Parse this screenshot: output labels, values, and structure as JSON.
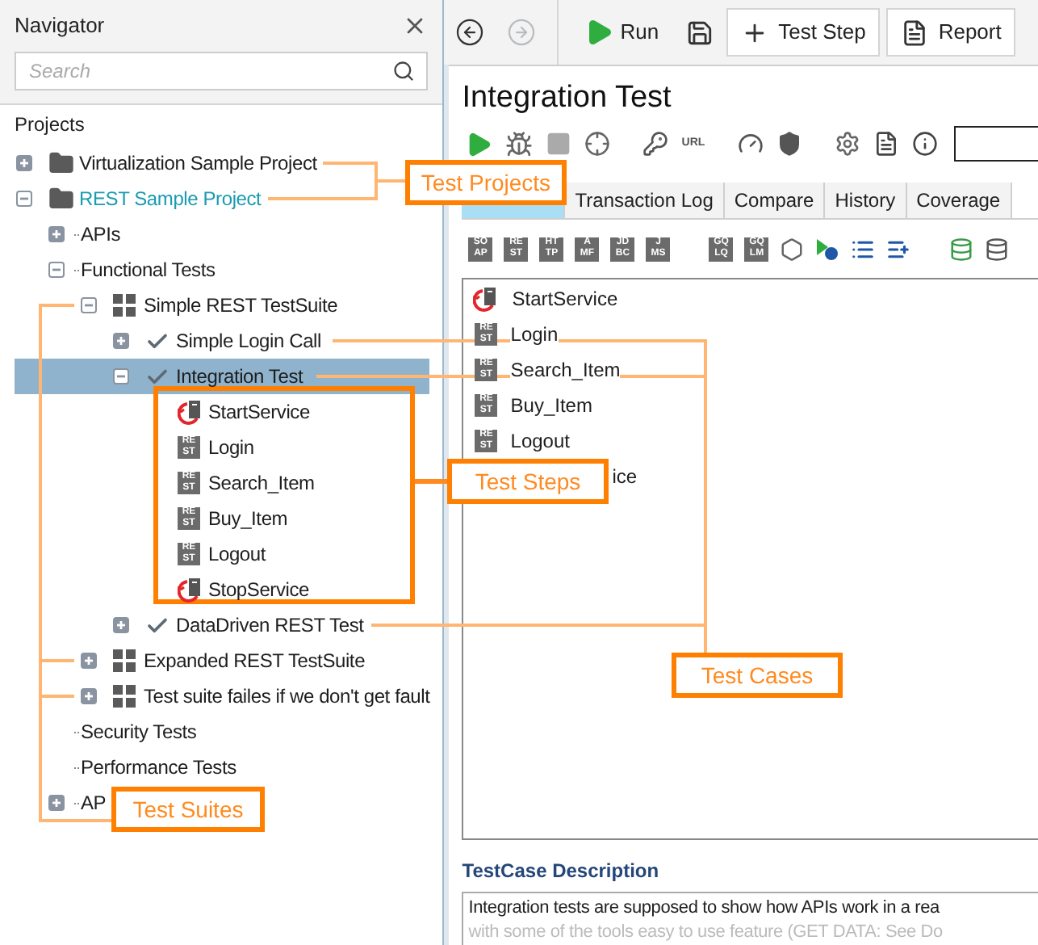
{
  "navigator": {
    "title": "Navigator",
    "search": {
      "placeholder": "Search"
    },
    "section": "Projects",
    "tree": [
      {
        "label": "Virtualization Sample Project",
        "kind": "project",
        "current": false,
        "selected": false,
        "expanded": false
      },
      {
        "label": "REST Sample Project",
        "kind": "project",
        "current": true,
        "selected": false,
        "expanded": true,
        "children": [
          {
            "label": "APIs",
            "kind": "folder",
            "selected": false,
            "expanded": false
          },
          {
            "label": "Functional Tests",
            "kind": "folder",
            "selected": false,
            "expanded": true,
            "children": [
              {
                "label": "Simple REST TestSuite",
                "kind": "suite",
                "selected": false,
                "expanded": true,
                "children": [
                  {
                    "label": "Simple Login Call",
                    "kind": "case",
                    "selected": false,
                    "expanded": false
                  },
                  {
                    "label": "Integration Test",
                    "kind": "case",
                    "selected": true,
                    "expanded": true,
                    "children": [
                      {
                        "label": "StartService",
                        "kind": "service",
                        "selected": false
                      },
                      {
                        "label": "Login",
                        "kind": "rest",
                        "badge": [
                          "RE",
                          "ST"
                        ],
                        "selected": false
                      },
                      {
                        "label": "Search_Item",
                        "kind": "rest",
                        "badge": [
                          "RE",
                          "ST"
                        ],
                        "selected": false
                      },
                      {
                        "label": "Buy_Item",
                        "kind": "rest",
                        "badge": [
                          "RE",
                          "ST"
                        ],
                        "selected": false
                      },
                      {
                        "label": "Logout",
                        "kind": "rest",
                        "badge": [
                          "RE",
                          "ST"
                        ],
                        "selected": false
                      },
                      {
                        "label": "StopService",
                        "kind": "service",
                        "selected": false
                      }
                    ]
                  },
                  {
                    "label": "DataDriven REST Test",
                    "kind": "case",
                    "selected": false,
                    "expanded": false
                  }
                ]
              },
              {
                "label": "Expanded REST TestSuite",
                "kind": "suite",
                "selected": false,
                "expanded": false
              },
              {
                "label": "Test suite failes if we don't get fault",
                "kind": "suite",
                "selected": false,
                "expanded": false
              }
            ]
          },
          {
            "label": "Security Tests",
            "kind": "folder",
            "selected": false
          },
          {
            "label": "Performance Tests",
            "kind": "folder",
            "selected": false
          },
          {
            "label": "AP",
            "kind": "folder",
            "selected": false,
            "expanded": false
          }
        ]
      }
    ]
  },
  "toolbar": [
    {
      "kind": "back",
      "disabled": false
    },
    {
      "kind": "forward",
      "disabled": true
    },
    {
      "kind": "run",
      "label": "Run"
    },
    {
      "kind": "save"
    },
    {
      "kind": "add",
      "label": "Test Step"
    },
    {
      "kind": "report",
      "label": "Report"
    }
  ],
  "editor": {
    "title": "Integration Test",
    "tools": [
      {
        "kind": "play"
      },
      {
        "kind": "bug"
      },
      {
        "kind": "stop"
      },
      {
        "kind": "target"
      },
      {
        "kind": "key"
      },
      {
        "kind": "url",
        "label": "URL"
      },
      {
        "kind": "gauge"
      },
      {
        "kind": "shield"
      },
      {
        "kind": "gear"
      },
      {
        "kind": "doc"
      },
      {
        "kind": "info"
      }
    ],
    "tabs": [
      {
        "selected": true
      },
      {
        "label": "Transaction Log",
        "selected": false
      },
      {
        "label": "Compare",
        "selected": false
      },
      {
        "label": "History",
        "selected": false
      },
      {
        "label": "Coverage",
        "selected": false
      }
    ],
    "step_types": [
      {
        "kind": "badge",
        "lines": [
          "SO",
          "AP"
        ]
      },
      {
        "kind": "badge",
        "lines": [
          "RE",
          "ST"
        ]
      },
      {
        "kind": "badge",
        "lines": [
          "HT",
          "TP"
        ]
      },
      {
        "kind": "badge",
        "lines": [
          "A",
          "MF"
        ]
      },
      {
        "kind": "badge",
        "lines": [
          "JD",
          "BC"
        ]
      },
      {
        "kind": "badge",
        "lines": [
          "J",
          "MS"
        ]
      },
      {
        "kind": "gap"
      },
      {
        "kind": "badge",
        "lines": [
          "GQ",
          "LQ"
        ]
      },
      {
        "kind": "badge",
        "lines": [
          "GQ",
          "LM"
        ]
      },
      {
        "kind": "graph"
      },
      {
        "kind": "run-step"
      },
      {
        "kind": "list"
      },
      {
        "kind": "insert"
      },
      {
        "kind": "gap"
      },
      {
        "kind": "db-down"
      },
      {
        "kind": "db-import"
      }
    ],
    "steps": [
      {
        "kind": "service",
        "name": "StartService"
      },
      {
        "kind": "rest",
        "badge": [
          "RE",
          "ST"
        ],
        "name": "Login"
      },
      {
        "kind": "rest",
        "badge": [
          "RE",
          "ST"
        ],
        "name": "Search_Item"
      },
      {
        "kind": "rest",
        "badge": [
          "RE",
          "ST"
        ],
        "name": "Buy_Item"
      },
      {
        "kind": "rest",
        "badge": [
          "RE",
          "ST"
        ],
        "name": "Logout"
      },
      {
        "kind": "covered",
        "name": "ice"
      }
    ],
    "description": {
      "label": "TestCase Description",
      "lines": [
        "Integration tests are supposed to show how APIs work in a rea",
        "with some of the tools easy to use feature (GET DATA: See Do"
      ]
    }
  },
  "callouts": [
    {
      "text": "Test Projects"
    },
    {
      "text": "Test Steps"
    },
    {
      "text": "Test Cases"
    },
    {
      "text": "Test Suites"
    }
  ]
}
